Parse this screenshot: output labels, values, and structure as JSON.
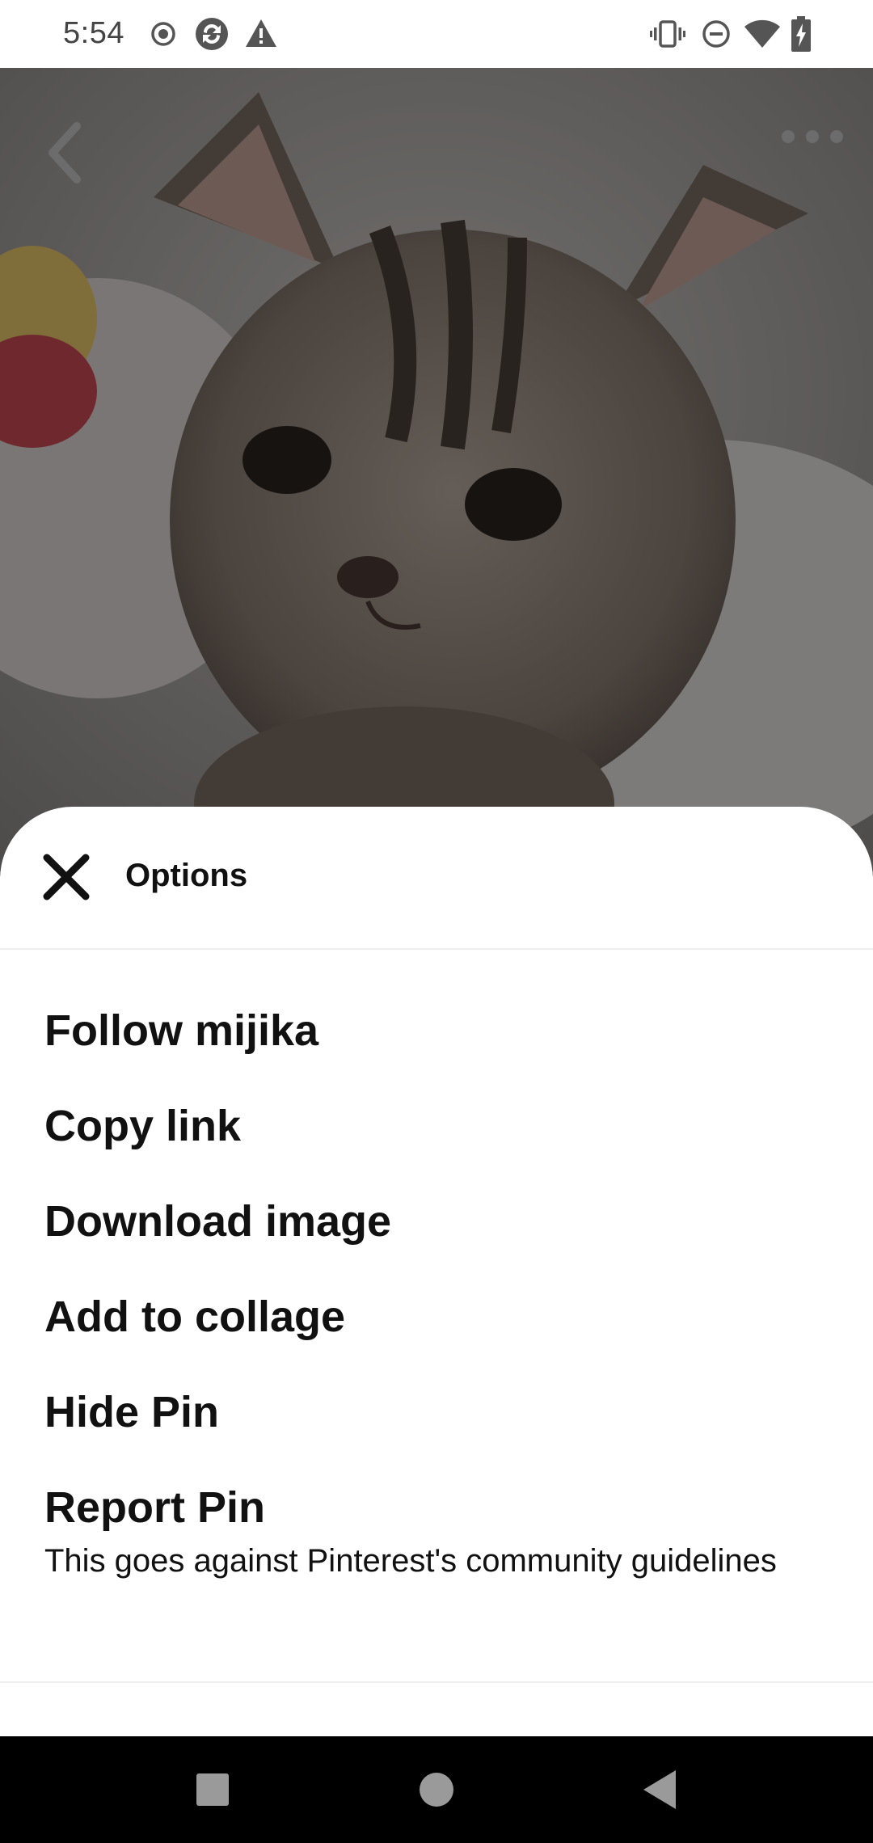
{
  "status_bar": {
    "time": "5:54",
    "left_icons": [
      "record-icon",
      "sync-icon",
      "warning-icon"
    ],
    "right_icons": [
      "vibrate-icon",
      "do-not-disturb-icon",
      "wifi-icon",
      "battery-charging-icon"
    ]
  },
  "pin": {
    "image_subject": "kitten photo",
    "back_icon": "chevron-left-icon",
    "more_icon": "more-horizontal-icon"
  },
  "sheet": {
    "title": "Options",
    "close_icon": "close-icon",
    "items": [
      {
        "label": "Follow mijika"
      },
      {
        "label": "Copy link"
      },
      {
        "label": "Download image"
      },
      {
        "label": "Add to collage"
      },
      {
        "label": "Hide Pin"
      },
      {
        "label": "Report Pin",
        "subtitle": "This goes against Pinterest's community guidelines"
      }
    ]
  },
  "nav_bar": {
    "buttons": [
      "recents-square-icon",
      "home-circle-icon",
      "back-triangle-icon"
    ]
  },
  "colors": {
    "sheet_background": "#ffffff",
    "text": "#111111",
    "nav_bar": "#000000",
    "overlay": "#000000"
  }
}
